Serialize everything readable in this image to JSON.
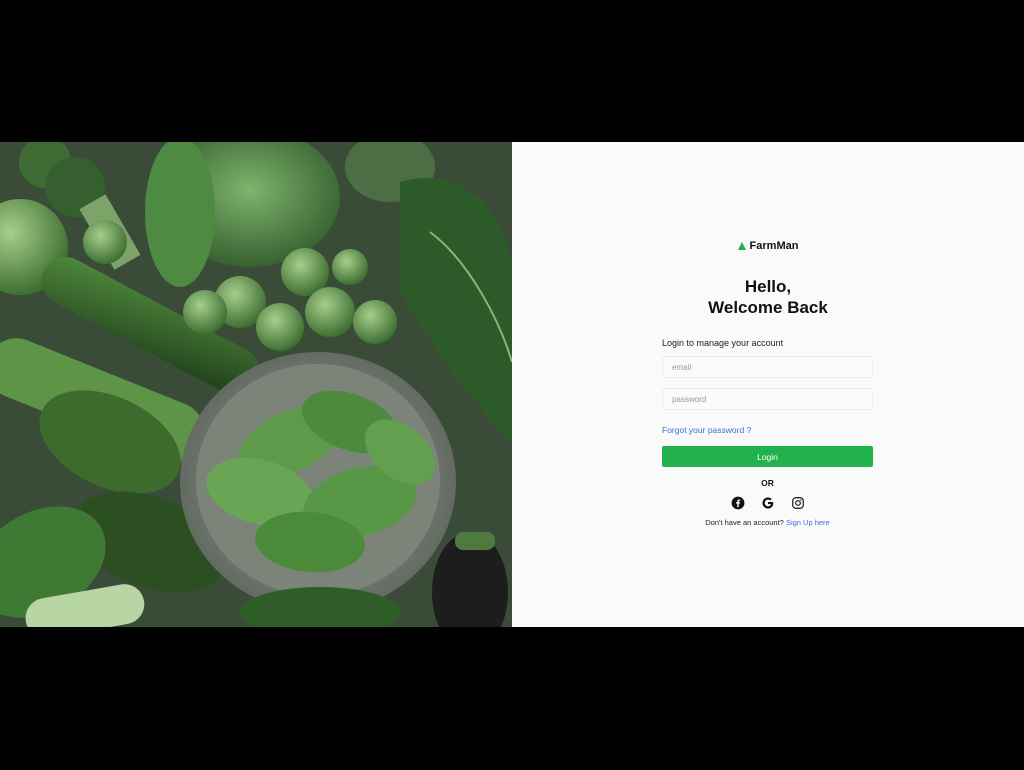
{
  "brand": {
    "name": "FarmMan",
    "icon": "triangle-logo-icon",
    "accent": "#22b24c"
  },
  "greeting": {
    "line1": "Hello,",
    "line2": "Welcome Back"
  },
  "form": {
    "subtitle": "Login to manage your account",
    "email_placeholder": "email",
    "password_placeholder": "password",
    "forgot_label": "Forgot your password ?",
    "login_label": "Login",
    "or_label": "OR"
  },
  "socials": [
    "facebook-icon",
    "google-icon",
    "instagram-icon"
  ],
  "signup": {
    "prompt": "Don't have an account?",
    "link": "Sign Up here"
  },
  "hero": {
    "description": "green-vegetables-photo"
  },
  "colors": {
    "link": "#3b6fd6",
    "button": "#22b24c",
    "panel": "#fafafa"
  }
}
